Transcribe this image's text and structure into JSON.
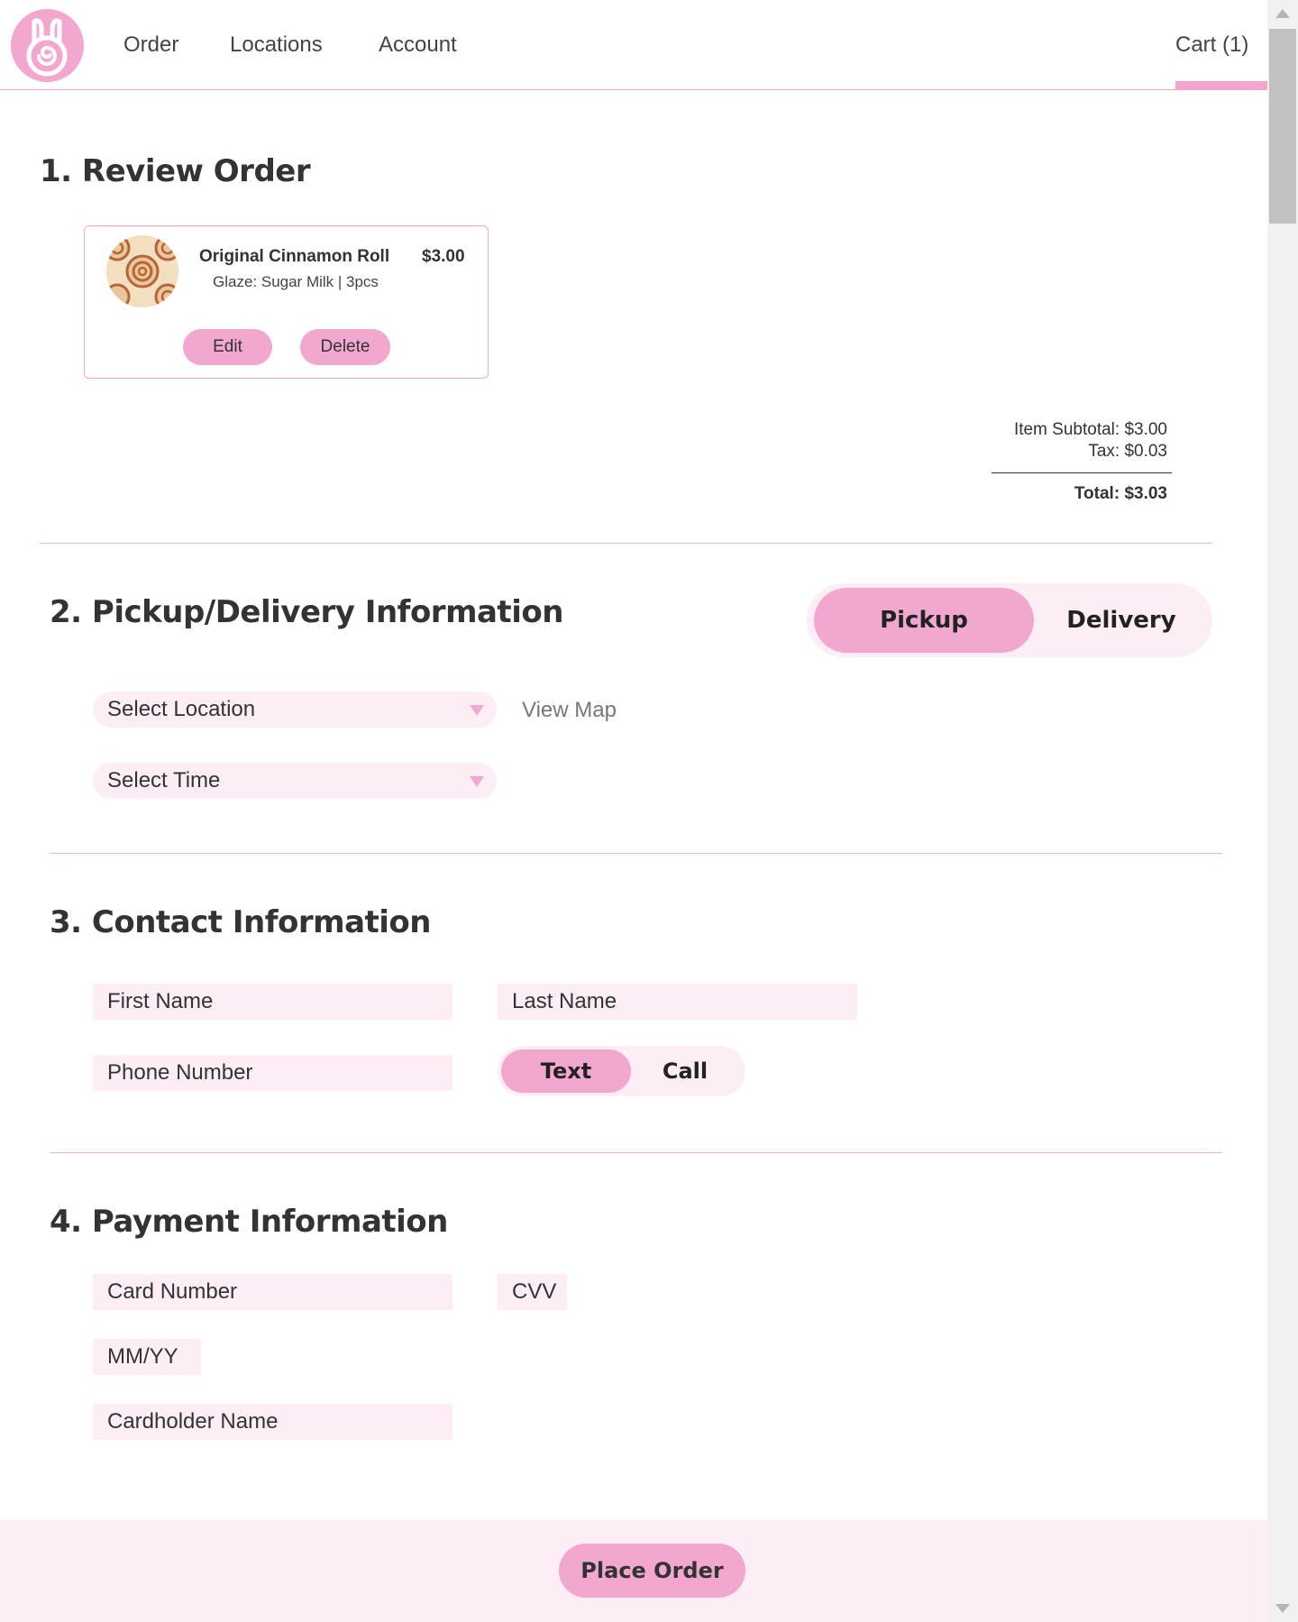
{
  "nav": {
    "items": [
      "Order",
      "Locations",
      "Account"
    ],
    "cart_label": "Cart (1)",
    "logo_icon": "bunny-cinnamon-roll-logo"
  },
  "review": {
    "title": "1. Review Order",
    "item": {
      "name": "Original Cinnamon Roll",
      "detail": "Glaze: Sugar Milk | 3pcs",
      "price": "$3.00",
      "image_icon": "cinnamon-roll-photo",
      "edit_label": "Edit",
      "delete_label": "Delete"
    },
    "totals": {
      "subtotal": "Item Subtotal: $3.00",
      "tax": "Tax: $0.03",
      "total": "Total: $3.03"
    }
  },
  "pickup": {
    "title": "2. Pickup/Delivery Information",
    "toggle": {
      "options": [
        "Pickup",
        "Delivery"
      ],
      "selected": "Pickup"
    },
    "location_placeholder": "Select Location",
    "time_placeholder": "Select Time",
    "view_map_label": "View Map"
  },
  "contact": {
    "title": "3. Contact Information",
    "first_name_placeholder": "First Name",
    "last_name_placeholder": "Last Name",
    "phone_placeholder": "Phone Number",
    "method_toggle": {
      "options": [
        "Text",
        "Call"
      ],
      "selected": "Text"
    }
  },
  "payment": {
    "title": "4. Payment Information",
    "card_number_placeholder": "Card Number",
    "cvv_placeholder": "CVV",
    "expiry_placeholder": "MM/YY",
    "cardholder_placeholder": "Cardholder Name"
  },
  "footer": {
    "place_order_label": "Place Order"
  },
  "colors": {
    "accent": "#f2a7cf",
    "field_bg": "#fdeef5",
    "text": "#333333"
  }
}
